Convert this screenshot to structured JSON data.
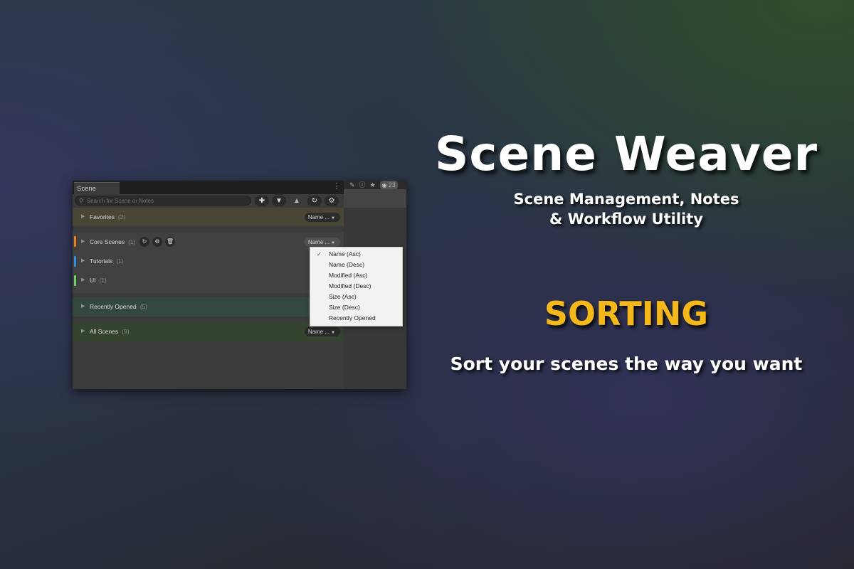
{
  "promo": {
    "title": "Scene Weaver",
    "subtitle_line1": "Scene Management, Notes",
    "subtitle_line2": "& Workflow Utility",
    "feature": "SORTING",
    "tagline": "Sort your scenes the way you want",
    "feature_color": "#f4b81a"
  },
  "window": {
    "tab_title": "Scene Weaver",
    "menu_icon": "vertical-dots-icon",
    "side_count": "23"
  },
  "toolbar": {
    "search_placeholder": "Search for Scene or Notes",
    "buttons": [
      "plus-icon",
      "triangle-down-icon",
      "triangle-up-icon",
      "refresh-icon",
      "gear-icon"
    ]
  },
  "sections": {
    "favorites": {
      "label": "Favorites",
      "count": "(2)",
      "sort": "Name ...",
      "bg": "#4a4636"
    },
    "core": {
      "label": "Core Scenes",
      "count": "(1)",
      "sort": "Name ...",
      "color": "#e8821e"
    },
    "tutorials": {
      "label": "Tutorials",
      "count": "(1)",
      "color": "#2d8fe0"
    },
    "ui": {
      "label": "UI",
      "count": "(1)",
      "color": "#6fd069"
    },
    "recent": {
      "label": "Recently Opened",
      "count": "(5)",
      "bg": "#33493f"
    },
    "all": {
      "label": "All Scenes",
      "count": "(9)",
      "sort": "Name ...",
      "bg": "#34442f"
    }
  },
  "sort_menu": {
    "selected": "Name (Asc)",
    "options": [
      "Name (Asc)",
      "Name (Desc)",
      "Modified (Asc)",
      "Modified (Desc)",
      "Size (Asc)",
      "Size (Desc)",
      "Recently Opened"
    ]
  }
}
